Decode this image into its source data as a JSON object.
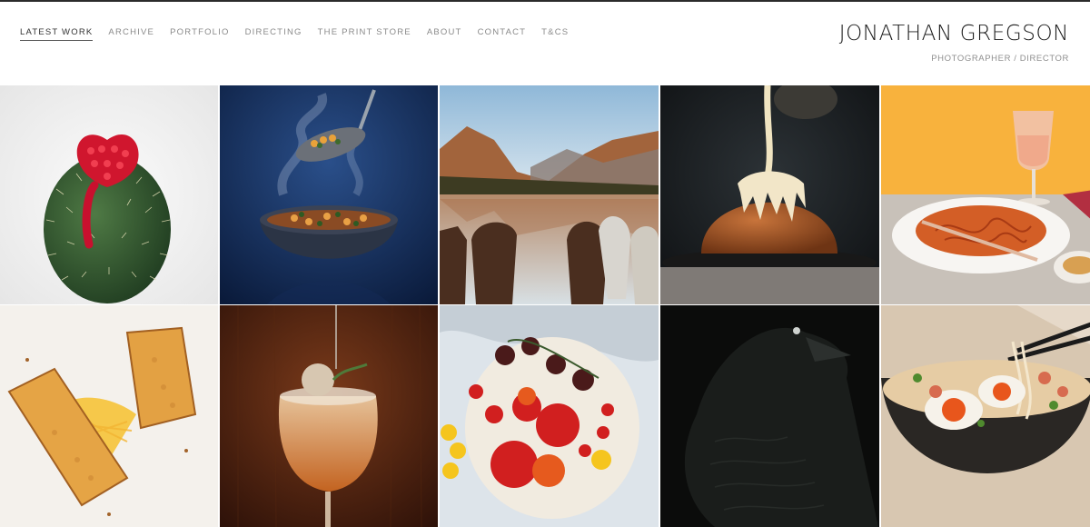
{
  "nav": {
    "items": [
      {
        "label": "LATEST WORK",
        "active": true
      },
      {
        "label": "ARCHIVE"
      },
      {
        "label": "PORTFOLIO"
      },
      {
        "label": "DIRECTING"
      },
      {
        "label": "THE PRINT STORE"
      },
      {
        "label": "ABOUT"
      },
      {
        "label": "CONTACT"
      },
      {
        "label": "T&CS"
      }
    ]
  },
  "brand": {
    "name": "JONATHAN GREGSON",
    "subtitle": "PHOTOGRAPHER / DIRECTOR"
  },
  "gallery": {
    "tiles": [
      {
        "subject": "cactus-raspberry"
      },
      {
        "subject": "soup-bowl-spoon"
      },
      {
        "subject": "mountain-lake-horses"
      },
      {
        "subject": "pudding-pour"
      },
      {
        "subject": "pasta-wine"
      },
      {
        "subject": "grilled-cheese-toast"
      },
      {
        "subject": "cocktail-glass"
      },
      {
        "subject": "tomato-plate"
      },
      {
        "subject": "raven"
      },
      {
        "subject": "ramen-bowl"
      }
    ]
  },
  "colors": {
    "accent_text": "#333333",
    "muted_text": "#8a8a8a",
    "top_border": "#2b2b2b"
  }
}
